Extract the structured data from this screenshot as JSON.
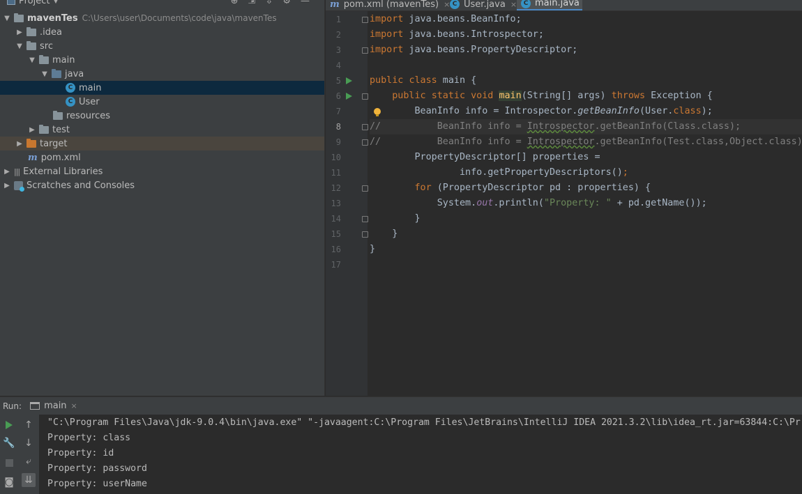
{
  "project": {
    "title": "Project",
    "header_icons": [
      "target-icon",
      "collapse-all-icon",
      "expand-icon",
      "gear-icon",
      "hide-icon"
    ],
    "tree": [
      {
        "label": "mavenTes",
        "hint": "C:\\Users\\user\\Documents\\code\\java\\mavenTes",
        "icon": "folder",
        "expanded": true
      },
      {
        "label": ".idea",
        "icon": "folder",
        "expanded": false
      },
      {
        "label": "src",
        "icon": "folder",
        "expanded": true
      },
      {
        "label": "main",
        "icon": "folder",
        "expanded": true
      },
      {
        "label": "java",
        "icon": "source-folder",
        "expanded": true
      },
      {
        "label": "main",
        "icon": "class",
        "selected": true
      },
      {
        "label": "User",
        "icon": "class"
      },
      {
        "label": "resources",
        "icon": "resources-folder"
      },
      {
        "label": "test",
        "icon": "folder",
        "expanded": false
      },
      {
        "label": "target",
        "icon": "excluded-folder",
        "expanded": false
      },
      {
        "label": "pom.xml",
        "icon": "maven"
      },
      {
        "label": "External Libraries",
        "icon": "library",
        "expanded": false
      },
      {
        "label": "Scratches and Consoles",
        "icon": "scratch",
        "expanded": false
      }
    ]
  },
  "editor": {
    "tabs": [
      {
        "label": "pom.xml (mavenTes)",
        "icon": "maven",
        "close": "×"
      },
      {
        "label": "User.java",
        "icon": "class",
        "close": "×"
      },
      {
        "label": "main.java",
        "icon": "class",
        "close": "",
        "active": true
      }
    ],
    "line_numbers": [
      "1",
      "2",
      "3",
      "4",
      "5",
      "6",
      "7",
      "8",
      "9",
      "10",
      "11",
      "12",
      "13",
      "14",
      "15",
      "16",
      "17"
    ],
    "current_line": 8,
    "code": {
      "l1_kw": "import",
      "l1_rest": " java.beans.BeanInfo;",
      "l2_kw": "import",
      "l2_rest": " java.beans.Introspector;",
      "l3_kw": "import",
      "l3_rest": " java.beans.PropertyDescriptor;",
      "l5_kw1": "public",
      "l5_kw2": "class",
      "l5_rest": " main {",
      "l6_kw1": "public",
      "l6_kw2": "static",
      "l6_kw3": "void",
      "l6_method": "main",
      "l6_mid": "(String[] args) ",
      "l6_kw4": "throws",
      "l6_end": " Exception {",
      "l7_a": "BeanInfo info = Introspector.",
      "l7_b": "getBeanInfo",
      "l7_c": "(User.",
      "l7_kw": "class",
      "l7_d": ");",
      "l8_slashes": "//",
      "l8_a": "          BeanInfo info = ",
      "l8_b": "Introspector",
      "l8_c": ".getBeanInfo(Class.class);",
      "l9_slashes": "//",
      "l9_a": "          BeanInfo info = ",
      "l9_b": "Introspector",
      "l9_c": ".getBeanInfo(Test.class,Object.class);",
      "l10": "PropertyDescriptor[] properties =",
      "l11_a": "info.getPropertyDescriptors()",
      "l11_b": ";",
      "l12_kw": "for",
      "l12_rest": " (PropertyDescriptor pd : properties) {",
      "l13_a": "System.",
      "l13_field": "out",
      "l13_b": ".println(",
      "l13_str": "\"Property: \"",
      "l13_c": " + pd.getName());",
      "l14": "}",
      "l15": "}",
      "l16": "}"
    }
  },
  "run": {
    "label": "Run:",
    "tab_label": "main",
    "tab_close": "×",
    "console_lines": [
      "\"C:\\Program Files\\Java\\jdk-9.0.4\\bin\\java.exe\" \"-javaagent:C:\\Program Files\\JetBrains\\IntelliJ IDEA 2021.3.2\\lib\\idea_rt.jar=63844:C:\\Pr",
      "Property: class",
      "Property: id",
      "Property: password",
      "Property: userName"
    ]
  },
  "colors": {
    "keyword": "#cc7832",
    "comment": "#808080",
    "string": "#6a8759",
    "selection": "#0d293e",
    "run_green": "#499c54",
    "class_icon": "#3592c4"
  }
}
